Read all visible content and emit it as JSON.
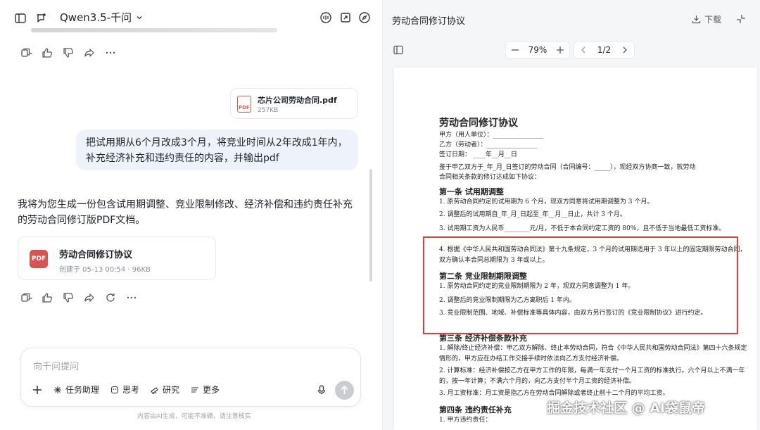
{
  "left": {
    "model_name": "Qwen3.5-千问",
    "file_card": {
      "name": "芯片公司劳动合同.pdf",
      "size": "257KB",
      "icon_label": "PDF"
    },
    "user_message": "把试用期从6个月改成3个月，将竞业时间从2年改成1年内，补充经济补充和违约责任的内容，并输出pdf",
    "ai_reply": "我将为您生成一份包含试用期调整、竞业限制修改、经济补偿和违约责任补充的劳动合同修订版PDF文档。",
    "doc_card": {
      "title": "劳动合同修订协议",
      "meta": "创建于 05-13 00:54 · 96KB",
      "icon_label": "PDF"
    },
    "input": {
      "placeholder": "向千问提问",
      "tools": [
        "任务助理",
        "思考",
        "研究",
        "更多"
      ]
    },
    "disclaimer": "内容由AI生成，可能不准确，请注意核实"
  },
  "right": {
    "title": "劳动合同修订协议",
    "download_label": "下载",
    "zoom": "79%",
    "page_indicator": "1/2",
    "pdf": {
      "title": "劳动合同修订协议",
      "party_a": "甲方（用人单位）：________________",
      "party_b": "乙方（劳动者）：________________",
      "sign_date": "签订日期：  ____年__月__日",
      "intro1": "鉴于甲乙双方于_年_月_日签订的劳动合同（合同编号：_____），现经双方协商一致，就劳动",
      "intro2": "合同相关条款的修订达成如下协议：",
      "s1": "第一条 试用期调整",
      "s1_items": [
        "1. 原劳动合同约定的试用期为 6 个月，现双方同意将试用期调整为 3 个月。",
        "2. 调整后的试用期自_年_月_日起至_年__月__日止，共计 3 个月。",
        "3. 试用期工资为人民币________元/月，不低于本合同约定工资的 80%，且不低于当地最低工资标准。",
        "4. 根据《中华人民共和国劳动合同法》第十九条规定，3 个月的试用期适用于 3 年以上的固定期限劳动合同，双方确认本合同总期限为 3 年或以上。"
      ],
      "s2": "第二条 竞业限制期限调整",
      "s2_items": [
        "1. 原劳动合同约定的竞业限制期限为 2 年，现双方同意调整为 1 年。",
        "2. 调整后的竞业限制期限为乙方离职后 1 年内。",
        "3. 竞业限制范围、地域、补偿标准等具体内容，由双方另行签订的《竞业限制协议》进行约定。"
      ],
      "s3": "第三条 经济补偿条款补充",
      "s3_items": [
        "1. 解除/终止经济补偿：甲乙双方解除、终止本劳动合同，符合《中华人民共和国劳动合同法》第四十六条规定情形的，甲方应在办结工作交接手续时依法向乙方支付经济补偿。",
        "2. 计算标准：经济补偿按乙方在甲方工作的年限，每满一年支付一个月工资的标准执行。六个月以上不满一年的，按一年计算；不满六个月的，向乙方支付半个月工资的经济补偿。",
        "3. 月工资标准：月工资是指乙方在劳动合同解除或者终止前十二个月的平均工资。"
      ],
      "s4": "第四条 违约责任补充",
      "s4_items": [
        "1. 甲方违约责任："
      ]
    }
  },
  "watermark": "掘金技术社区 @ AI袋鼠帝"
}
